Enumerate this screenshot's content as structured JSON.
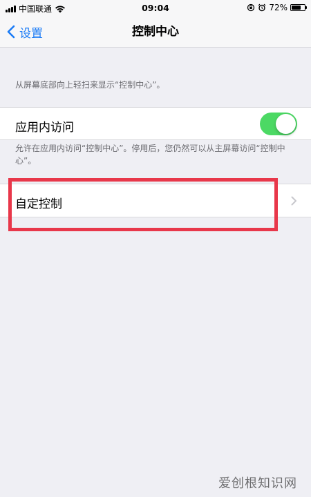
{
  "status_bar": {
    "carrier": "中国联通",
    "time": "09:04",
    "battery": "72%",
    "battery_level": 0.72
  },
  "nav": {
    "back_label": "设置",
    "title": "控制中心"
  },
  "content": {
    "hint": "从屏幕底部向上轻扫来显示“控制中心”。",
    "app_access": {
      "label": "应用内访问",
      "enabled": true,
      "footer": "允许在应用内访问“控制中心”。停用后，您仍然可以从主屏幕访问“控制中心”。"
    },
    "customize": {
      "label": "自定控制"
    }
  },
  "watermark": "爱创根知识网",
  "colors": {
    "accent": "#1a7bf6",
    "toggle_on": "#4cd964",
    "highlight": "#e8374a",
    "background": "#efeff4"
  }
}
